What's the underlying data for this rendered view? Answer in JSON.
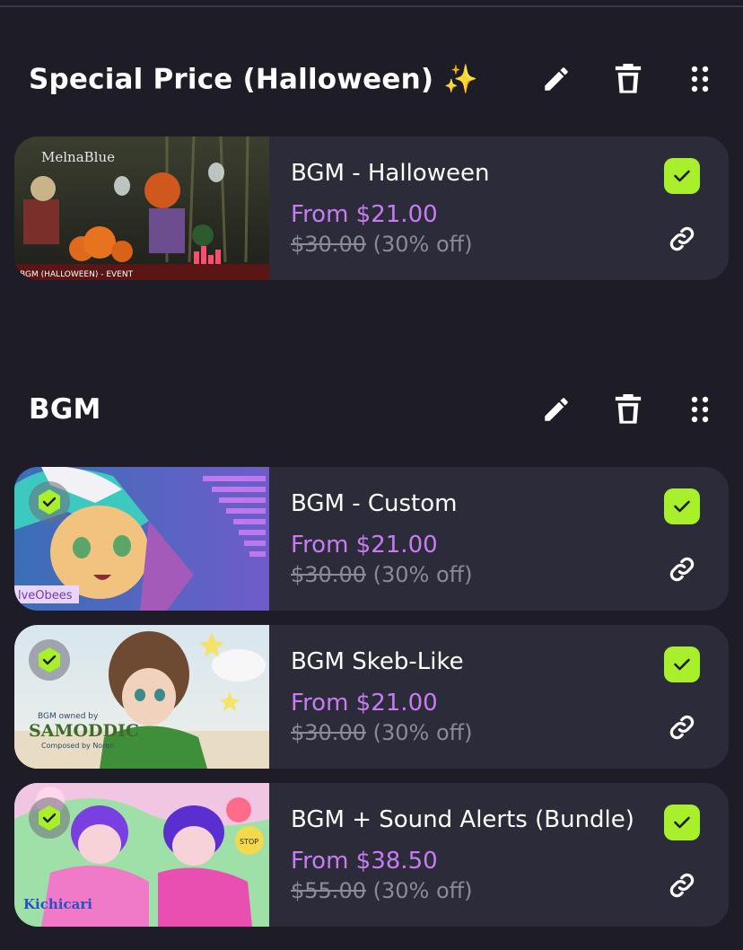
{
  "colors": {
    "background": "#1d1c27",
    "card": "#2c2b39",
    "price": "#c77cf2",
    "old_price": "#8c8a99",
    "check": "#a8f02b"
  },
  "sections": [
    {
      "title": "Special Price (Halloween) ✨",
      "icons": [
        "pencil-icon",
        "trash-icon",
        "drag-handle-icon"
      ],
      "items": [
        {
          "title": "BGM - Halloween",
          "price": "From $21.00",
          "old_price": "$30.00",
          "discount": "(30% off)",
          "selected": true,
          "thumbnail_text": [
            "MelnaBlue",
            "BGM (HALLOWEEN) - EVENT"
          ]
        }
      ]
    },
    {
      "title": "BGM",
      "icons": [
        "pencil-icon",
        "trash-icon",
        "drag-handle-icon"
      ],
      "items": [
        {
          "title": "BGM - Custom",
          "price": "From $21.00",
          "old_price": "$30.00",
          "discount": "(30% off)",
          "selected": true,
          "thumbnail_text": [
            "lveObees"
          ]
        },
        {
          "title": "BGM Skeb-Like",
          "price": "From $21.00",
          "old_price": "$30.00",
          "discount": "(30% off)",
          "selected": true,
          "thumbnail_text": [
            "BGM owned by",
            "SAMODDIC",
            "Composed by Noren"
          ]
        },
        {
          "title": "BGM + Sound Alerts (Bundle)",
          "price": "From $38.50",
          "old_price": "$55.00",
          "discount": "(30% off)",
          "selected": true,
          "thumbnail_text": [
            "Kichicari",
            "STOP"
          ]
        }
      ]
    }
  ]
}
